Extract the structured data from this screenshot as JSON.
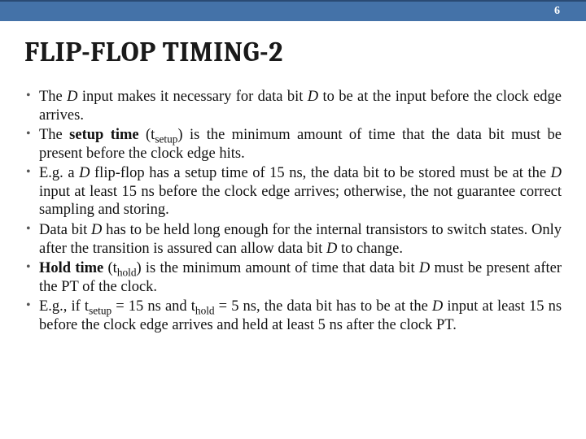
{
  "page_number": "6",
  "title": "FLIP-FLOP TIMING-2",
  "bullets": [
    {
      "pre": "The ",
      "em1": "D",
      "mid1": " input makes it necessary for data bit ",
      "em2": "D",
      "post": " to be at the input before the clock edge arrives."
    },
    {
      "pre": "The ",
      "b1": "setup time",
      "mid1": " (t",
      "sub1": "setup",
      "post": ") is the minimum amount of time that the data bit must be present before the clock edge hits."
    },
    {
      "pre": "E.g. a ",
      "em1": "D",
      "mid1": " flip-flop has a setup time of 15 ns, the data bit to be stored must be at the ",
      "em2": "D",
      "post": " input at least 15 ns before the clock edge arrives; otherwise, the not guarantee correct sampling and storing."
    },
    {
      "pre": "Data bit ",
      "em1": "D",
      "mid1": " has to be held long enough for the internal transistors to switch states. Only after the transition is assured can allow data bit ",
      "em2": "D",
      "post": " to change."
    },
    {
      "b1": "Hold time",
      "mid1": " (t",
      "sub1": "hold",
      "mid2": ") is the minimum amount of time that data bit ",
      "em1": "D",
      "post": " must be present after the PT of the clock."
    },
    {
      "pre": "E.g., if t",
      "sub1": "setup",
      "mid1": " = 15 ns and t",
      "sub2": "hold",
      "mid2": " = 5 ns, the data bit has to be at the ",
      "em1": "D",
      "post": " input at least 15 ns before the clock edge arrives and held at least 5 ns after the clock PT."
    }
  ]
}
